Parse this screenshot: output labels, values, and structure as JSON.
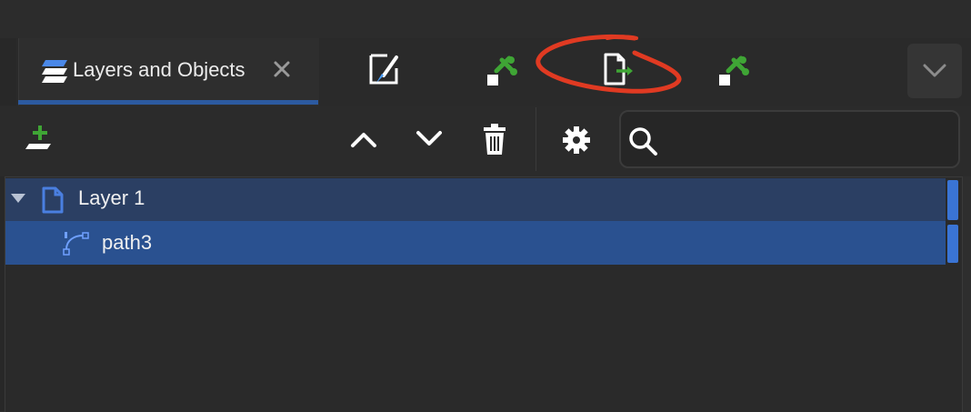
{
  "tab": {
    "title": "Layers and Objects"
  },
  "tab_icons": [
    "fill-stroke-icon",
    "tool-wrench-icon",
    "export-document-icon",
    "tool-wrench-icon"
  ],
  "toolbar": {
    "buttons": [
      "add-layer-icon",
      "raise-icon",
      "lower-icon",
      "delete-icon",
      "settings-icon",
      "search-icon"
    ]
  },
  "tree": {
    "layer": {
      "label": "Layer 1",
      "expanded": true
    },
    "child": {
      "label": "path3",
      "selected": true
    }
  },
  "colors": {
    "accent": "#2c5aa0",
    "selection": "#2a5190",
    "layer_row": "#2b3f63",
    "icon_blue": "#4a7fe0",
    "icon_green": "#3fa535",
    "annotation": "#e03a22"
  }
}
